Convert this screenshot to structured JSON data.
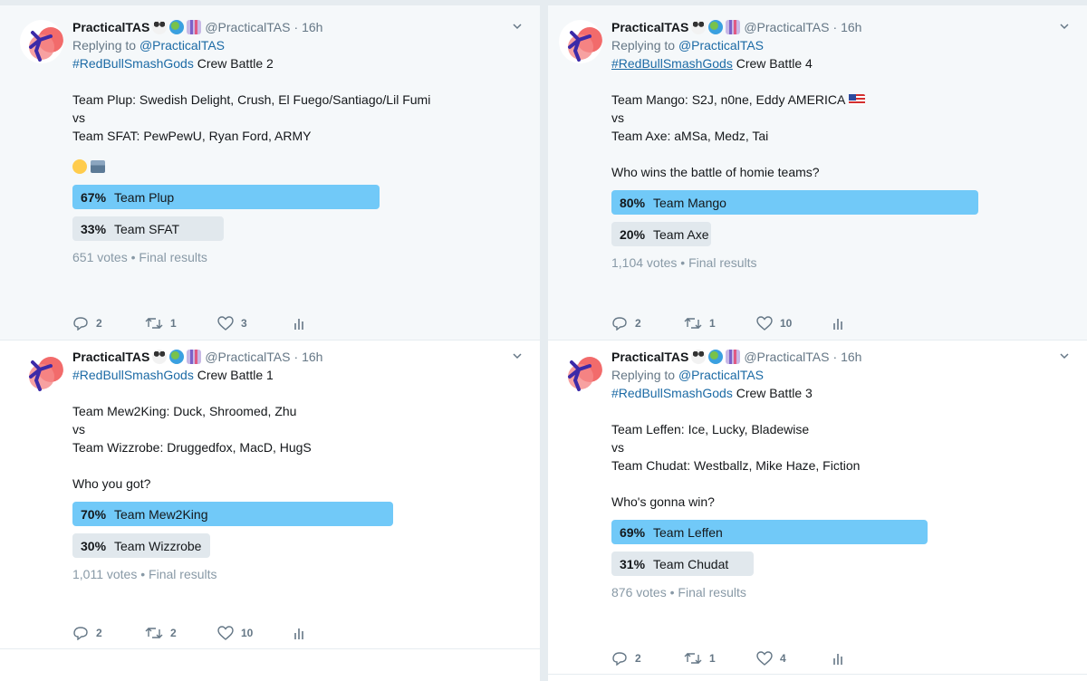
{
  "author": {
    "name": "PracticalTAS",
    "handle": "@PracticalTAS",
    "time": "16h"
  },
  "reply_prefix": "Replying to",
  "tweets": [
    {
      "reply_to": "@PracticalTAS",
      "hashtag": "#RedBullSmashGods",
      "battle": " Crew Battle 2",
      "line1": "Team Plup: Swedish Delight, Crush, El Fuego/Santiago/Lil Fumi",
      "vs": "vs",
      "line2": "Team SFAT: PewPewU, Ryan Ford, ARMY",
      "question": "",
      "emoji_names": [
        "thinking-face-icon",
        "ballot-box-icon"
      ],
      "options": [
        {
          "pct": "67%",
          "label": "Team Plup",
          "value": 0.67
        },
        {
          "pct": "33%",
          "label": "Team SFAT",
          "value": 0.33
        }
      ],
      "votes": "651 votes",
      "status": "Final results",
      "replies": "2",
      "retweets": "1",
      "likes": "3"
    },
    {
      "reply_to": "@PracticalTAS",
      "hashtag": "#RedBullSmashGods",
      "battle": " Crew Battle 4",
      "line1": "Team Mango: S2J, n0ne, Eddy AMERICA",
      "vs": "vs",
      "line2": "Team Axe: aMSa, Medz, Tai",
      "question": "Who wins the battle of homie teams?",
      "options": [
        {
          "pct": "80%",
          "label": "Team Mango",
          "value": 0.8
        },
        {
          "pct": "20%",
          "label": "Team Axe",
          "value": 0.2
        }
      ],
      "votes": "1,104 votes",
      "status": "Final results",
      "replies": "2",
      "retweets": "1",
      "likes": "10"
    },
    {
      "hashtag": "#RedBullSmashGods",
      "battle": " Crew Battle 1",
      "line1": "Team Mew2King: Duck, Shroomed, Zhu",
      "vs": "vs",
      "line2": "Team Wizzrobe: Druggedfox, MacD, HugS",
      "question": "Who you got?",
      "options": [
        {
          "pct": "70%",
          "label": "Team Mew2King",
          "value": 0.7
        },
        {
          "pct": "30%",
          "label": "Team Wizzrobe",
          "value": 0.3
        }
      ],
      "votes": "1,011 votes",
      "status": "Final results",
      "replies": "2",
      "retweets": "2",
      "likes": "10"
    },
    {
      "reply_to": "@PracticalTAS",
      "hashtag": "#RedBullSmashGods",
      "battle": " Crew Battle 3",
      "line1": "Team Leffen: Ice, Lucky, Bladewise",
      "vs": "vs",
      "line2": "Team Chudat: Westballz, Mike Haze, Fiction",
      "question": "Who's gonna win?",
      "options": [
        {
          "pct": "69%",
          "label": "Team Leffen",
          "value": 0.69
        },
        {
          "pct": "31%",
          "label": "Team Chudat",
          "value": 0.31
        }
      ],
      "votes": "876 votes",
      "status": "Final results",
      "replies": "2",
      "retweets": "1",
      "likes": "4"
    }
  ],
  "colors": {
    "poll_winner": "#71c9f8",
    "poll_loser": "#e1e8ed",
    "link": "#1b6aa5",
    "muted": "#657786"
  }
}
